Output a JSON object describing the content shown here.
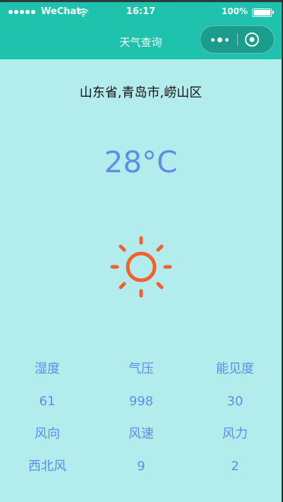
{
  "status_bar": {
    "carrier": "WeChat",
    "time": "16:17",
    "battery": "100%"
  },
  "nav": {
    "title": "天气查询"
  },
  "weather": {
    "location": "山东省,青岛市,崂山区",
    "temperature": "28°C",
    "condition_icon": "sun-icon"
  },
  "details": {
    "humidity_label": "湿度",
    "pressure_label": "气压",
    "visibility_label": "能见度",
    "humidity_value": "61",
    "pressure_value": "998",
    "visibility_value": "30",
    "wind_direction_label": "风向",
    "wind_speed_label": "风速",
    "wind_force_label": "风力",
    "wind_direction_value": "西北风",
    "wind_speed_value": "9",
    "wind_force_value": "2"
  },
  "colors": {
    "header": "#1fc3ad",
    "background": "#b2ecec",
    "accent": "#5f8ee8",
    "sun": "#f4602b"
  }
}
